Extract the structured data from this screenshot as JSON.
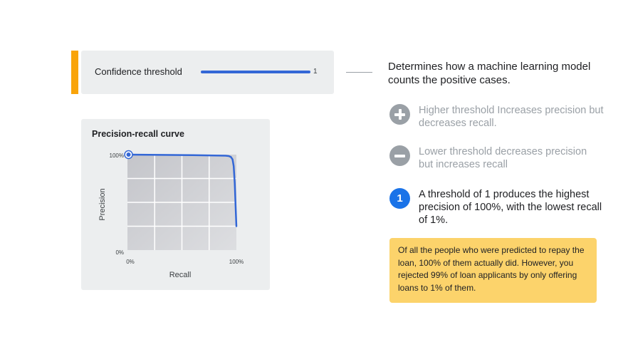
{
  "threshold": {
    "label": "Confidence threshold",
    "value": "1",
    "slider_fraction": 1
  },
  "description": "Determines how a machine learning model counts the positive cases.",
  "hints": [
    {
      "icon": "plus-circle-icon",
      "text": "Higher threshold Increases precision but decreases recall."
    },
    {
      "icon": "minus-circle-icon",
      "text": "Lower threshold decreases precision but increases recall"
    },
    {
      "icon": "number-one-icon",
      "badge": "1",
      "text": "A threshold of 1 produces the highest precision of 100%, with the lowest recall of 1%."
    }
  ],
  "note": "Of all the people who were predicted to repay the loan, 100% of them actually did. However, you rejected 99% of loan applicants by only offering loans to 1% of them.",
  "colors": {
    "accent": "#f9a40a",
    "curve": "#3367d6",
    "highlight": "#1a73e8",
    "note_background": "#fcd36b",
    "muted": "#9aa0a6"
  },
  "chart_data": {
    "type": "line",
    "title": "Precision-recall curve",
    "xlabel": "Recall",
    "ylabel": "Precision",
    "x_ticks": [
      "0%",
      "100%"
    ],
    "y_ticks": [
      "0%",
      "100%"
    ],
    "xlim": [
      0,
      100
    ],
    "ylim": [
      0,
      100
    ],
    "grid": true,
    "series": [
      {
        "x": [
          0,
          20,
          40,
          60,
          80,
          90,
          93,
          95,
          96.5,
          97.5,
          98.5,
          99.5,
          100
        ],
        "y": [
          100,
          99.8,
          99.6,
          99.4,
          99.1,
          98.9,
          98.5,
          97.5,
          95,
          88,
          70,
          40,
          25
        ]
      }
    ],
    "highlight_point": {
      "x": 1,
      "y": 100
    }
  }
}
